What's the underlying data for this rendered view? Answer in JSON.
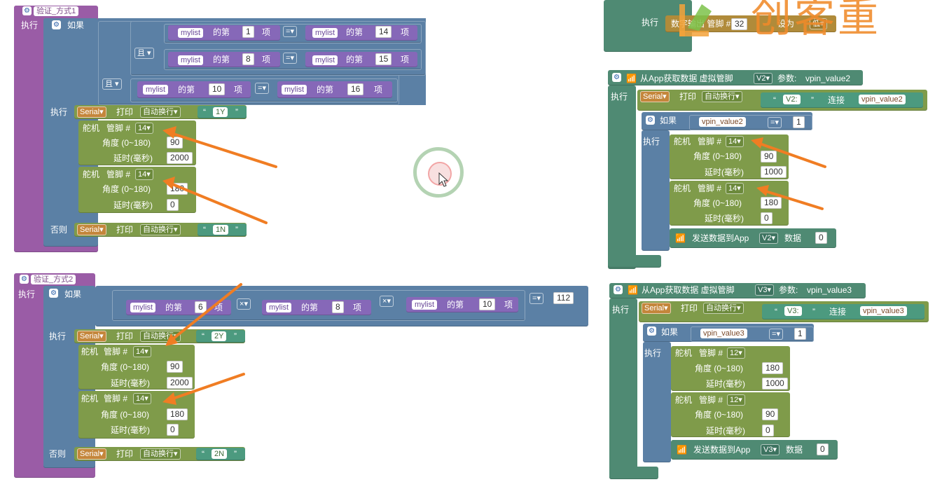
{
  "brand": {
    "logo_text": "创客重"
  },
  "common": {
    "exec": "执行",
    "if": "如果",
    "else": "否则",
    "and": "且",
    "mylist": "mylist",
    "nth": "的第",
    "item": "项",
    "serial": "Serial",
    "print": "打印",
    "newline": "自动换行",
    "servo": "舵机",
    "pin": "管脚 #",
    "angle": "角度 (0~180)",
    "delay": "延时(毫秒)",
    "eq": "=",
    "mul": "×",
    "join": "连接",
    "send_app": "发送数据到App",
    "data": "数据",
    "param": "参数:",
    "app_get": "从App获取数据 虚拟管脚"
  },
  "func1": {
    "title": "验证_方式1",
    "conds": [
      {
        "a": "1",
        "b": "14"
      },
      {
        "a": "8",
        "b": "15"
      },
      {
        "a": "10",
        "b": "16"
      }
    ],
    "print_then": "1Y",
    "servos": [
      {
        "pin": "14",
        "angle": "90",
        "delay": "2000"
      },
      {
        "pin": "14",
        "angle": "180",
        "delay": "0"
      }
    ],
    "print_else": "1N"
  },
  "func2": {
    "title": "验证_方式2",
    "factors": [
      "6",
      "8",
      "10"
    ],
    "target": "112",
    "print_then": "2Y",
    "servos": [
      {
        "pin": "14",
        "angle": "90",
        "delay": "2000"
      },
      {
        "pin": "14",
        "angle": "180",
        "delay": "0"
      }
    ],
    "print_else": "2N"
  },
  "top_right": {
    "label": "数字输出 管脚 #",
    "pin": "32",
    "set": "设为",
    "value": "低"
  },
  "v2": {
    "vpin": "V2",
    "param": "vpin_value2",
    "str": "V2:",
    "cmp": "1",
    "servos": [
      {
        "pin": "14",
        "angle": "90",
        "delay": "1000"
      },
      {
        "pin": "14",
        "angle": "180",
        "delay": "0"
      }
    ],
    "send_val": "0"
  },
  "v3": {
    "vpin": "V3",
    "param": "vpin_value3",
    "str": "V3:",
    "cmp": "1",
    "servos": [
      {
        "pin": "12",
        "angle": "180",
        "delay": "1000"
      },
      {
        "pin": "12",
        "angle": "90",
        "delay": "0"
      }
    ],
    "send_val": "0"
  },
  "colors": {
    "arrow": "#f07d23",
    "function": "#9a5ca6",
    "logic": "#5b80a5",
    "servo": "#7f9b4a"
  }
}
